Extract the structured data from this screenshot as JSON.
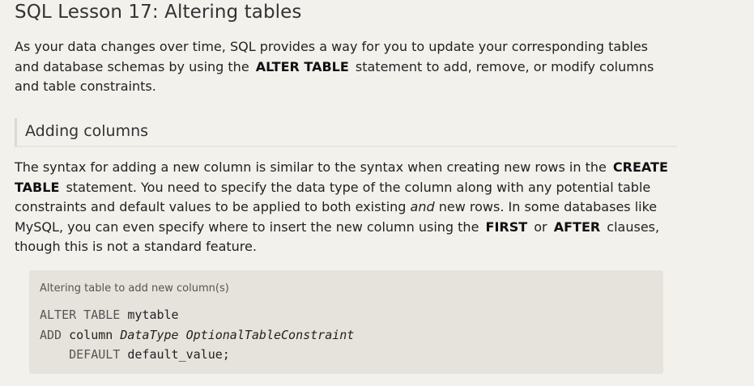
{
  "lesson": {
    "title": "SQL Lesson 17: Altering tables"
  },
  "intro": {
    "text_1": "As your data changes over time, SQL provides a way for you to update your corresponding tables and database schemas by using the",
    "keyword": "ALTER TABLE",
    "text_2": "statement to add, remove, or modify columns and table constraints."
  },
  "section": {
    "title": "Adding columns"
  },
  "body": {
    "text_1": "The syntax for adding a new column is similar to the syntax when creating new rows in the",
    "keyword_create": "CREATE TABLE",
    "text_2": "statement. You need to specify the data type of the column along with any potential table constraints and default values to be applied to both existing",
    "emphasis": "and",
    "text_3": "new rows. In some databases like MySQL, you can even specify where to insert the new column using the",
    "keyword_first": "FIRST",
    "text_or": "or",
    "keyword_after": "AFTER",
    "text_4": "clauses, though this is not a standard feature."
  },
  "code_example": {
    "caption": "Altering table to add new column(s)",
    "line1_kw": "ALTER TABLE",
    "line1_name": "mytable",
    "line2_kw": "ADD",
    "line2_col": "column",
    "line2_type": "DataType",
    "line2_constraint": "OptionalTableConstraint",
    "line3_kw": "DEFAULT",
    "line3_value": "default_value;"
  }
}
